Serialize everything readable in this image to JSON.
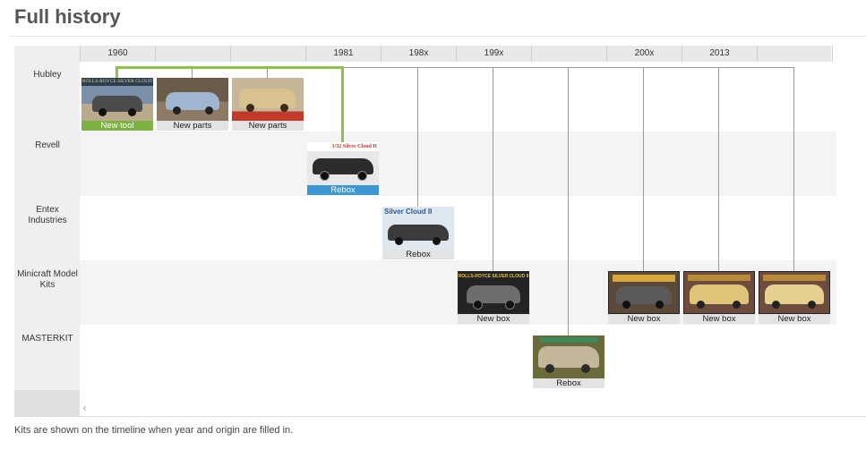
{
  "page": {
    "title": "Full history",
    "footnote": "Kits are shown on the timeline when year and origin are filled in."
  },
  "timeline": {
    "columns": [
      "1960",
      "",
      "",
      "1981",
      "198x",
      "199x",
      "",
      "200x",
      "2013",
      ""
    ],
    "makers": [
      "Hubley",
      "Revell",
      "Entex Industries",
      "Minicraft Model Kits",
      "MASTERKIT"
    ],
    "kits": [
      {
        "caption": "New tool",
        "style": "green",
        "box_text": "ROLLS-ROYCE SILVER CLOUD",
        "palette": {
          "bg": "#7a8fa8",
          "car": "#4b4b4b",
          "ground": "#b9a98d"
        }
      },
      {
        "caption": "New parts",
        "style": "plain",
        "box_text": "",
        "palette": {
          "bg": "#6b5a48",
          "car": "#9fb6d1",
          "ground": "#8c7a64"
        }
      },
      {
        "caption": "New parts",
        "style": "plain",
        "box_text": "",
        "palette": {
          "bg": "#c7b59a",
          "car": "#d8c290",
          "ground": "#c0392b"
        }
      },
      {
        "caption": "Rebox",
        "style": "blue",
        "box_text": "1/32 Silver Cloud II",
        "palette": {
          "bg": "#e8e8e8",
          "car": "#2c2c2c",
          "ground": "#d6d6d6"
        }
      },
      {
        "caption": "Rebox",
        "style": "plain",
        "box_text": "Silver Cloud II",
        "palette": {
          "bg": "#dfe7ef",
          "car": "#3b3b3b",
          "ground": "#c4cdd6"
        }
      },
      {
        "caption": "New box",
        "style": "plain",
        "box_text": "ROLLS-ROYCE SILVER CLOUD II",
        "palette": {
          "bg": "#232323",
          "car": "#6d6d6d",
          "ground": "#3a3a3a"
        }
      },
      {
        "caption": "New box",
        "style": "plain",
        "box_text": "",
        "palette": {
          "bg": "#5b4a3a",
          "car": "#5a5a5a",
          "ground": "#8a6f45"
        }
      },
      {
        "caption": "New box",
        "style": "plain",
        "box_text": "",
        "palette": {
          "bg": "#6d4c3d",
          "car": "#e0c47a",
          "ground": "#8c5a3c"
        }
      },
      {
        "caption": "New box",
        "style": "plain",
        "box_text": "",
        "palette": {
          "bg": "#6d4c3d",
          "car": "#e6d08d",
          "ground": "#8c5a3c"
        }
      },
      {
        "caption": "Rebox",
        "style": "plain",
        "box_text": "",
        "palette": {
          "bg": "#6a6a3a",
          "car": "#c4b69a",
          "ground": "#9a8b6c"
        }
      }
    ]
  },
  "colors": {
    "green_line": "#8bc34a",
    "gray_line": "#999999",
    "rebox_blue": "#3c97d3",
    "newtool_green": "#7cb342"
  },
  "icons": {
    "scroll_left": "‹"
  }
}
